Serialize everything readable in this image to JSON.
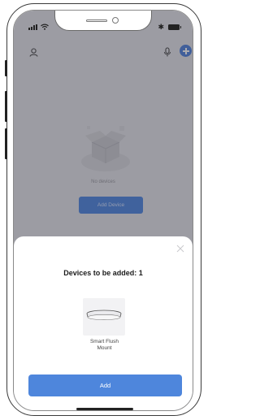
{
  "status_bar": {
    "icons": [
      "signal-icon",
      "wifi-icon",
      "bluetooth-icon",
      "battery-icon"
    ],
    "bluetooth_glyph": "✱"
  },
  "background_screen": {
    "empty_text": "No devices",
    "add_device_label": "Add Device",
    "icons": [
      "user-icon",
      "microphone-icon",
      "plus-icon"
    ]
  },
  "sheet": {
    "title": "Devices to be added: 1",
    "device": {
      "name": "Smart Flush Mount",
      "icon": "ceiling-light-icon"
    },
    "add_label": "Add",
    "close_icon": "close-icon"
  },
  "colors": {
    "accent": "#4e86dc",
    "accent_dimmed": "#3b78dc",
    "plus_button": "#3c74d8",
    "background_dim": "#e2e2e7",
    "sheet_bg": "#ffffff"
  }
}
